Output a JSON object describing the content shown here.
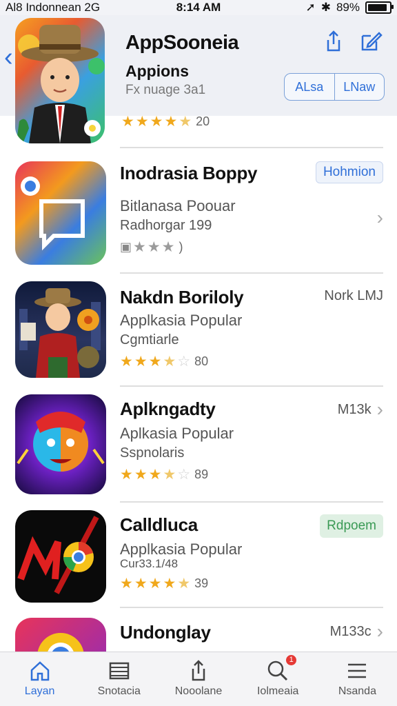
{
  "status_bar": {
    "carrier": "Indonnean 2G",
    "signal": "Al8",
    "time": "8:14 AM",
    "battery": "89%"
  },
  "header": {
    "title": "AppSooneia",
    "subtitle": "Appions",
    "meta": "Fx nuage 3a1",
    "rating_count": "20",
    "segment": [
      "ALsa",
      "LNaw"
    ]
  },
  "apps": [
    {
      "name": "Inodrasia Boppy",
      "category": "Bitlanasa Poouar",
      "sub": "Radhorgar 199",
      "rating_count": ")",
      "right_label": "Hohmion",
      "right_style": "badge-blue"
    },
    {
      "name": "Nakdn Boriloly",
      "category": "Applkasia Popular",
      "sub": "Cgmtiarle",
      "rating_count": "80",
      "right_label": "Nork LMJ",
      "right_style": "plain"
    },
    {
      "name": "Aplkngadty",
      "category": "Aplkasia Popular",
      "sub": "Sspnolaris",
      "rating_count": "89",
      "right_label": "M13k",
      "right_style": "chevron"
    },
    {
      "name": "Calldluca",
      "category": "Applkasia Popular",
      "sub": "Cur33.1/48",
      "rating_count": "39",
      "right_label": "Rdpoem",
      "right_style": "badge-green"
    },
    {
      "name": "Undonglay",
      "category": "",
      "sub": "",
      "rating_count": "",
      "right_label": "M133c",
      "right_style": "chevron"
    }
  ],
  "tabbar": [
    {
      "label": "Layan",
      "icon": "home-icon"
    },
    {
      "label": "Snotacia",
      "icon": "list-icon"
    },
    {
      "label": "Nooolane",
      "icon": "share-icon"
    },
    {
      "label": "Iolmeaia",
      "icon": "search-icon",
      "badge": "1"
    },
    {
      "label": "Nsanda",
      "icon": "menu-icon"
    }
  ],
  "colors": {
    "accent": "#2f6fd8",
    "star": "#f0a81c",
    "header_bg": "#eef0f5"
  }
}
